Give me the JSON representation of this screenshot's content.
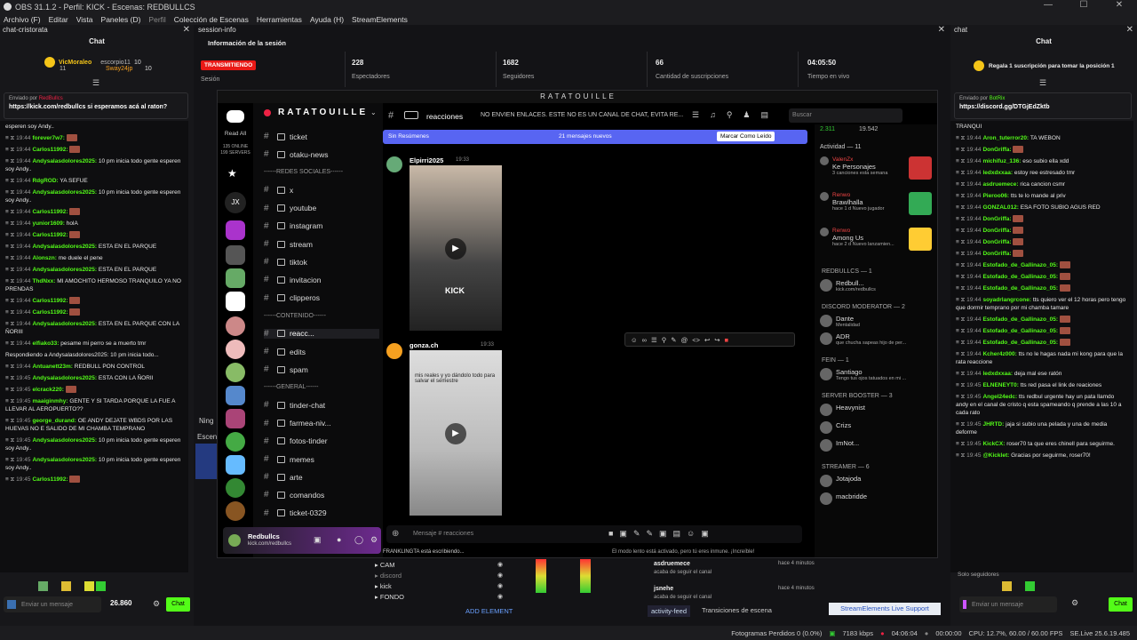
{
  "titlebar": {
    "text": "OBS 31.1.2 - Perfil: KICK - Escenas: REDBULLCS"
  },
  "menu": [
    "Archivo (F)",
    "Editar",
    "Vista",
    "Paneles (D)",
    "Perfil",
    "Colección de Escenas",
    "Herramientas",
    "Ayuda (H)",
    "StreamElements"
  ],
  "left_dock": {
    "tab": "chat-cristorata",
    "title": "Chat",
    "top_user": "VicMoraleo",
    "top_count": "11",
    "others": [
      {
        "name": "escorpio11",
        "count": "10"
      },
      {
        "name": "Sway24jp",
        "count": "10"
      }
    ],
    "pinned_by": "Enviado por",
    "pinned_user": "RedBullcs",
    "pinned_text": "https://kick.com/redbullcs si esperamos acá al raton?",
    "messages": [
      {
        "time": "",
        "user": "",
        "text": "esperen soy Andy.."
      },
      {
        "time": "19:44",
        "user": "forever7w7:",
        "text": ""
      },
      {
        "time": "19:44",
        "user": "Carlos11992:",
        "text": ""
      },
      {
        "time": "19:44",
        "user": "Andysalasdolores2025:",
        "text": "10 pm inicia todo gente esperen soy Andy.."
      },
      {
        "time": "19:44",
        "user": "RdgROD:",
        "text": "YA SEFUE"
      },
      {
        "time": "19:44",
        "user": "Andysalasdolores2025:",
        "text": "10 pm inicia todo gente esperen soy Andy.."
      },
      {
        "time": "19:44",
        "user": "Carlos11992:",
        "text": ""
      },
      {
        "time": "19:44",
        "user": "yunior1609:",
        "text": "holA"
      },
      {
        "time": "19:44",
        "user": "Carlos11992:",
        "text": ""
      },
      {
        "time": "19:44",
        "user": "Andysalasdolores2025:",
        "text": "ESTA EN EL PARQUE"
      },
      {
        "time": "19:44",
        "user": "Alonszn:",
        "text": "me duele el pene"
      },
      {
        "time": "19:44",
        "user": "Andysalasdolores2025:",
        "text": "ESTA EN EL PARQUE"
      },
      {
        "time": "19:44",
        "user": "ThdNxx:",
        "text": "MI AMOCHITO HERMOSO TRANQUILO YA NO PRENDAS"
      },
      {
        "time": "19:44",
        "user": "Carlos11992:",
        "text": ""
      },
      {
        "time": "19:44",
        "user": "Carlos11992:",
        "text": ""
      },
      {
        "time": "19:44",
        "user": "Andysalasdolores2025:",
        "text": "ESTA EN EL PARQUE CON LA ÑORIII"
      },
      {
        "time": "19:44",
        "user": "elfiako33:",
        "text": "pesame mi perro se a muerto tmr"
      },
      {
        "time": "",
        "user": "",
        "text": "Respondiendo a Andysalasdolores2025: 10 pm inicia todo..."
      },
      {
        "time": "19:44",
        "user": "Antuanett23m:",
        "text": "REDBULL PON CONTROL"
      },
      {
        "time": "19:45",
        "user": "Andysalasdolores2025:",
        "text": "ESTA CON LA ÑORII"
      },
      {
        "time": "19:45",
        "user": "elcrack220:",
        "text": ""
      },
      {
        "time": "19:45",
        "user": "maaiginmhy:",
        "text": "GENTE Y SI TARDA PORQUE LA FUE A LLEVAR AL AEROPUERTO??"
      },
      {
        "time": "19:45",
        "user": "george_durand:",
        "text": "OE ANDY DEJATE WBDS POR LAS HUEVAS NO E SALIDO DE MI CHAMBA TEMPRANO"
      },
      {
        "time": "19:45",
        "user": "Andysalasdolores2025:",
        "text": "10 pm inicia todo gente esperen soy Andy.."
      },
      {
        "time": "19:45",
        "user": "Andysalasdolores2025:",
        "text": "10 pm inicia todo gente esperen soy Andy.."
      },
      {
        "time": "19:45",
        "user": "Carlos11992:",
        "text": ""
      }
    ],
    "input_placeholder": "Enviar un mensaje",
    "points": "26.860",
    "chat_btn": "Chat"
  },
  "session": {
    "tab": "session-info",
    "title": "Información de la sesión",
    "status": "TRANSMITIENDO",
    "session_label": "Sesión",
    "stats": [
      {
        "value": "228",
        "label": "Espectadores"
      },
      {
        "value": "1682",
        "label": "Seguidores"
      },
      {
        "value": "66",
        "label": "Cantidad de suscripciones"
      },
      {
        "value": "04:05:50",
        "label": "Tiempo en vivo"
      }
    ]
  },
  "right_dock": {
    "tab": "chat",
    "title": "Chat",
    "gift_banner": "Regala 1 suscripción para tomar la posición 1",
    "pinned_by": "Enviado por",
    "pinned_user": "BotRix",
    "pinned_text": "https://discord.gg/DTGjEdZktb",
    "messages": [
      {
        "time": "",
        "user": "",
        "text": "TRANQUI"
      },
      {
        "time": "19:44",
        "user": "Aron_tuterror20:",
        "text": "TA WEBON"
      },
      {
        "time": "19:44",
        "user": "DonGriffa:",
        "text": ""
      },
      {
        "time": "19:44",
        "user": "michifuz_136:",
        "text": "eso subio ella xdd"
      },
      {
        "time": "19:44",
        "user": "ledxdxxaa:",
        "text": "estoy ree estresado tmr"
      },
      {
        "time": "19:44",
        "user": "asdruemece:",
        "text": "rica cancion csmr"
      },
      {
        "time": "19:44",
        "user": "Pieroo06:",
        "text": "tts te lo mande al priv"
      },
      {
        "time": "19:44",
        "user": "GONZAL012:",
        "text": "ESA FOTO SUBIO AGUS RED"
      },
      {
        "time": "19:44",
        "user": "DonGriffa:",
        "text": ""
      },
      {
        "time": "19:44",
        "user": "DonGriffa:",
        "text": ""
      },
      {
        "time": "19:44",
        "user": "DonGriffa:",
        "text": ""
      },
      {
        "time": "19:44",
        "user": "DonGriffa:",
        "text": ""
      },
      {
        "time": "19:44",
        "user": "Estofado_de_Gallinazo_05:",
        "text": ""
      },
      {
        "time": "19:44",
        "user": "Estofado_de_Gallinazo_05:",
        "text": ""
      },
      {
        "time": "19:44",
        "user": "Estofado_de_Gallinazo_05:",
        "text": ""
      },
      {
        "time": "19:44",
        "user": "soyadrlangrcone:",
        "text": "tts quiero ver el 12 horas pero tengo que dormir temprano por mi chamba tamare"
      },
      {
        "time": "19:44",
        "user": "Estofado_de_Gallinazo_05:",
        "text": ""
      },
      {
        "time": "19:44",
        "user": "Estofado_de_Gallinazo_05:",
        "text": ""
      },
      {
        "time": "19:44",
        "user": "Estofado_de_Gallinazo_05:",
        "text": ""
      },
      {
        "time": "19:44",
        "user": "Kcher4z000:",
        "text": "tts no le hagas nada mi kong para que la rata reaccione"
      },
      {
        "time": "19:44",
        "user": "ledxdxxaa:",
        "text": "deja mal ese ratón"
      },
      {
        "time": "19:45",
        "user": "ELNENEYT0:",
        "text": "tts red pasa el link de reaciones"
      },
      {
        "time": "19:45",
        "user": "Angel24edc:",
        "text": "tts redbul urgente hay un pata llamdo andy en el canal de cristo q esta spameando q prende a las 10 a cada rato"
      },
      {
        "time": "19:45",
        "user": "JHRTD:",
        "text": "jaja si subio una pelada y una de media deforme"
      },
      {
        "time": "19:45",
        "user": "KickCX:",
        "text": "roser70 ta que eres chinell para seguirme."
      },
      {
        "time": "19:45",
        "user": "@Kicklet:",
        "text": "Gracias por seguirme, roser70!"
      }
    ],
    "followers_only": "Solo seguidores",
    "input_placeholder": "Enviar un mensaje",
    "chat_btn": "Chat"
  },
  "discord": {
    "window_title": "RATATOUILLE",
    "server_name": "RATATOUILLE",
    "read_all": "Read All",
    "online": "135 ONLINE",
    "servers": "199 SERVERS",
    "channel_header": "reacciones",
    "topic": "NO ENVIEN ENLACES. ESTE NO ES UN CANAL DE CHAT, EVITA RE...",
    "search_placeholder": "Buscar",
    "channels": [
      {
        "name": "ticket",
        "type": "text"
      },
      {
        "name": "otaku-news",
        "type": "text"
      },
      {
        "name": "------REDES SOCIALES------",
        "type": "cat"
      },
      {
        "name": "x",
        "type": "text"
      },
      {
        "name": "youtube",
        "type": "text"
      },
      {
        "name": "instagram",
        "type": "text"
      },
      {
        "name": "stream",
        "type": "text"
      },
      {
        "name": "tiktok",
        "type": "text"
      },
      {
        "name": "invitacion",
        "type": "text"
      },
      {
        "name": "clipperos",
        "type": "text"
      },
      {
        "name": "------CONTENIDO------",
        "type": "cat"
      },
      {
        "name": "reacc...",
        "type": "text"
      },
      {
        "name": "edits",
        "type": "text"
      },
      {
        "name": "spam",
        "type": "text"
      },
      {
        "name": "------GENERAL------",
        "type": "cat"
      },
      {
        "name": "tinder-chat",
        "type": "text"
      },
      {
        "name": "farmea-niv...",
        "type": "text"
      },
      {
        "name": "fotos-tinder",
        "type": "text"
      },
      {
        "name": "memes",
        "type": "text"
      },
      {
        "name": "arte",
        "type": "text"
      },
      {
        "name": "comandos",
        "type": "text"
      },
      {
        "name": "ticket-0329",
        "type": "text"
      }
    ],
    "unread_bar": {
      "left": "Sin Resúmenes",
      "center": "21 mensajes nuevos",
      "right": "Marcar Como Leído"
    },
    "messages": [
      {
        "author": "Elpirri2025",
        "time": "19:33"
      },
      {
        "author": "gonza.ch",
        "time": "19:33"
      }
    ],
    "video_caption": "mis reales y yo dándolo todo para salvar el semestre",
    "video_watermark": "KICK",
    "composer_placeholder": "Mensaje #  reacciones",
    "typing": "FRANKLINGTA está escribiendo...",
    "slowmode": "El modo lento está activado, pero tú eres inmune. ¡Increíble!",
    "user_name": "Redbullcs",
    "user_sub": "kick.com/redbullcs",
    "members": {
      "stats": [
        "2.311",
        "19.542"
      ],
      "activity_title": "Actividad — 11",
      "activities": [
        {
          "name": "ValenZx",
          "game": "Ke Personajes",
          "sub": "3 canciones esta semana"
        },
        {
          "name": "Renwo",
          "game": "Brawlhalla",
          "sub": "hace 1 d   Nuevo jugador"
        },
        {
          "name": "Renwo",
          "game": "Among Us",
          "sub": "hace 2 d   Nuevo lanzamien..."
        }
      ],
      "groups": [
        {
          "title": "REDBULLCS — 1",
          "items": [
            {
              "name": "Redbull...",
              "sub": "kick.com/redbullcs"
            }
          ]
        },
        {
          "title": "DISCORD MODERATOR — 2",
          "items": [
            {
              "name": "Dante",
              "sub": "Mentalidad"
            },
            {
              "name": "ADR",
              "sub": "que chucha sapeas hijo de per..."
            }
          ]
        },
        {
          "title": "FEIN — 1",
          "items": [
            {
              "name": "Santiago",
              "sub": "Tengo tus ojos tatuados en mi ..."
            }
          ]
        },
        {
          "title": "SERVER BOOSTER — 3",
          "items": [
            {
              "name": "Heavynist",
              "sub": ""
            },
            {
              "name": "Crizs",
              "sub": ""
            },
            {
              "name": "ImNot...",
              "sub": ""
            }
          ]
        },
        {
          "title": "STREAMER — 6",
          "items": [
            {
              "name": "Jotajoda",
              "sub": ""
            },
            {
              "name": "macbridde",
              "sub": ""
            }
          ]
        }
      ]
    }
  },
  "bottom": {
    "sources": [
      "CAM",
      "discord",
      "kick",
      "FONDO"
    ],
    "add_element": "ADD ELEMENT",
    "scenes_label": "Escen",
    "ning": "Ning",
    "feed": [
      {
        "user": "asdruemece",
        "text": "acaba de seguir el canal",
        "time": "hace 4 minutos"
      },
      {
        "user": "jsnehe",
        "text": "acaba de seguir el canal",
        "time": "hace 4 minutos"
      }
    ],
    "tabs": [
      "activity-feed",
      "Transiciones de escena"
    ],
    "se_btn": "StreamElements Live Support"
  },
  "status": {
    "dropped": "Fotogramas Perdidos 0 (0.0%)",
    "kbps": "7183 kbps",
    "live_time": "04:06:04",
    "rec_time": "00:00:00",
    "cpu": "CPU: 12.7%, 60.00 / 60.00 FPS",
    "version": "SE.Live 25.6.19.485"
  }
}
